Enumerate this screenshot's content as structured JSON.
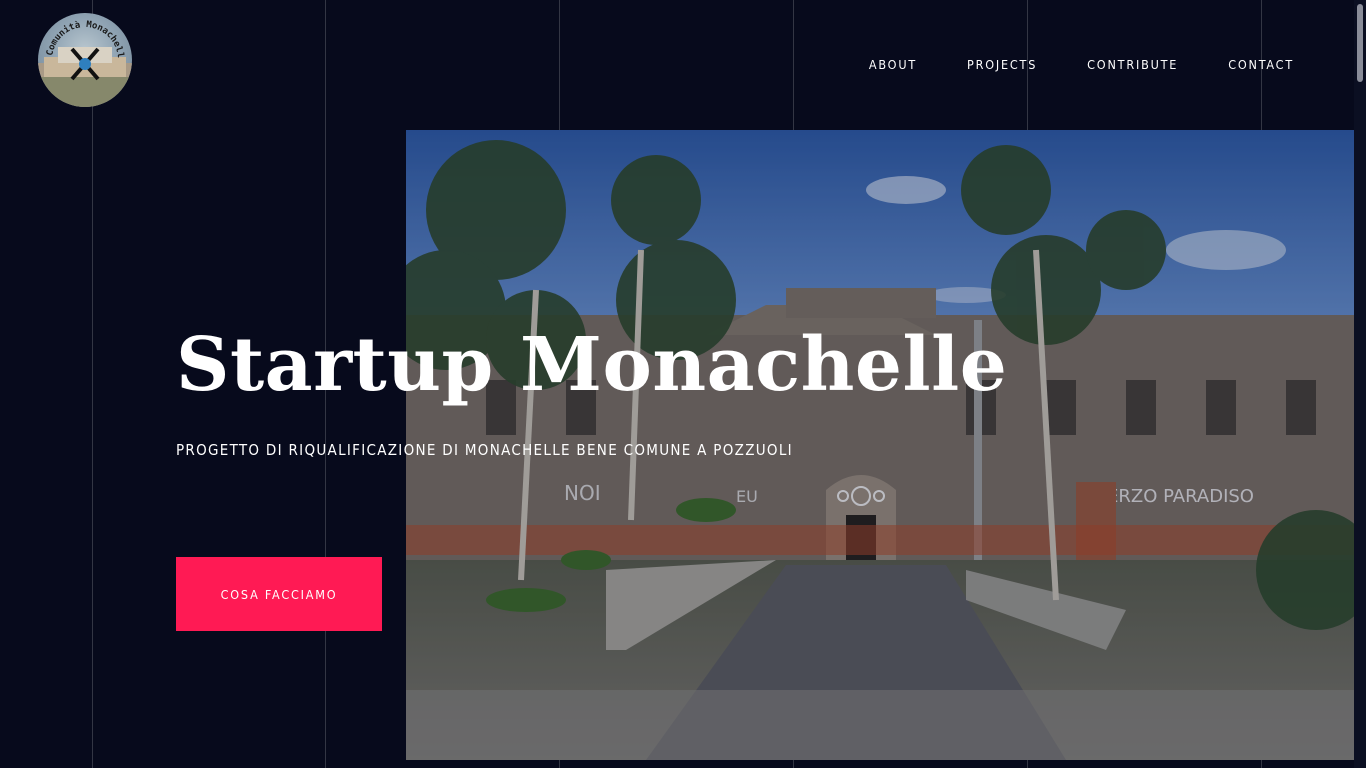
{
  "header": {
    "logo": {
      "alt": "Comunità Monachelle",
      "ring_text": "Comunità Monachelle"
    },
    "nav": [
      {
        "label": "ABOUT"
      },
      {
        "label": "PROJECTS"
      },
      {
        "label": "CONTRIBUTE"
      },
      {
        "label": "CONTACT"
      }
    ]
  },
  "hero": {
    "title": "Startup Monachelle",
    "subtitle": "PROGETTO DI RIQUALIFICAZIONE DI MONACHELLE BENE COMUNE A POZZUOLI",
    "cta_label": "COSA FACCIAMO",
    "image": {
      "graffiti_left": "NOI",
      "graffiti_mid": "EU",
      "graffiti_right": "TERZO PARADISO"
    }
  },
  "colors": {
    "background": "#070a1c",
    "accent": "#ff1a54",
    "text": "#ffffff"
  }
}
